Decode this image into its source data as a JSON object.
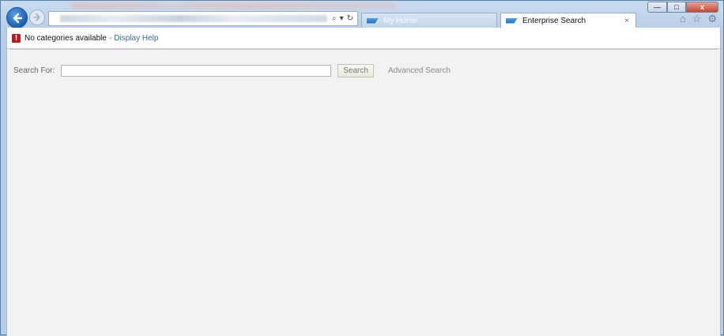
{
  "browser": {
    "tabs": [
      {
        "label": "My Home",
        "icon": "sap-logo-icon"
      },
      {
        "label": "Enterprise Search",
        "icon": "sap-logo-icon",
        "close": "×"
      }
    ],
    "address": {
      "refresh_symbol": "↻",
      "search_symbol": "⌕"
    },
    "window_controls": {
      "minimize": "—",
      "maximize": "□",
      "close": "x"
    },
    "toolbar_icons": [
      "home-icon",
      "favorites-star-icon",
      "settings-gear-icon"
    ]
  },
  "message": {
    "icon": "!",
    "text": "No categories available",
    "separator": "-",
    "link": "Display Help"
  },
  "search": {
    "label": "Search For:",
    "value": "",
    "button": "Search",
    "advanced": "Advanced Search"
  },
  "colors": {
    "error": "#c8141e",
    "link": "#2f6aa6",
    "content_bg": "#f2f2f2"
  }
}
